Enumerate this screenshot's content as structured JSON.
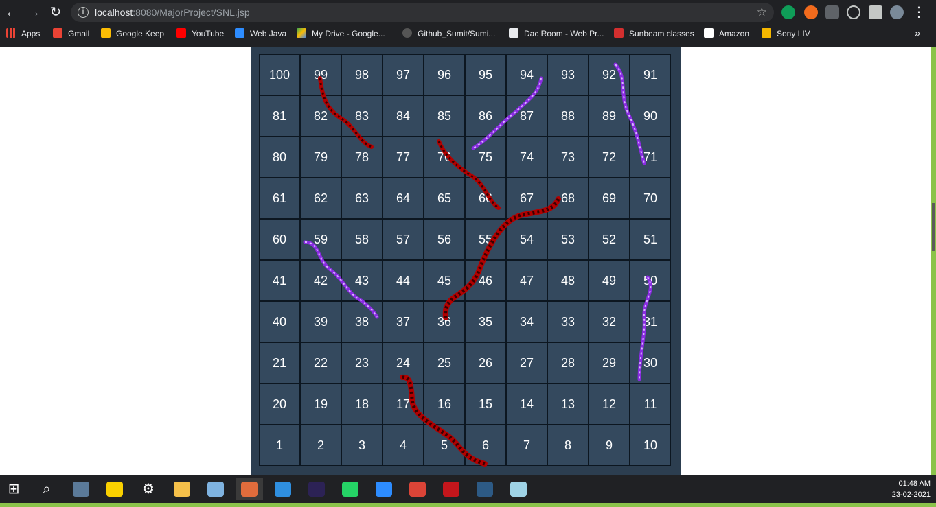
{
  "browser": {
    "url_host": "localhost",
    "url_path": ":8080/MajorProject/SNL.jsp",
    "back_icon": "←",
    "forward_icon": "→",
    "reload_icon": "↻",
    "star_icon": "☆",
    "menu_icon": "⋮",
    "bookmarks": [
      {
        "label": "Apps",
        "color": "#ea4335"
      },
      {
        "label": "Gmail",
        "color": "#ea4335"
      },
      {
        "label": "Google Keep",
        "color": "#fbbc04"
      },
      {
        "label": "YouTube",
        "color": "#ff0000"
      },
      {
        "label": "Web Java",
        "color": "#2d8cff"
      },
      {
        "label": "My Drive - Google...",
        "color": "#34a853"
      },
      {
        "label": "Github_Sumit/Sumi...",
        "color": "#555555"
      },
      {
        "label": "Dac Room - Web Pr...",
        "color": "#ffffff"
      },
      {
        "label": "Sunbeam classes",
        "color": "#d32f2f"
      },
      {
        "label": "Amazon",
        "color": "#ffffff"
      },
      {
        "label": "Sony LIV",
        "color": "#f5b700"
      }
    ],
    "more_bookmarks": "»"
  },
  "board": {
    "rows": [
      [
        "100",
        "99",
        "98",
        "97",
        "96",
        "95",
        "94",
        "93",
        "92",
        "91"
      ],
      [
        "81",
        "82",
        "83",
        "84",
        "85",
        "86",
        "87",
        "88",
        "89",
        "90"
      ],
      [
        "80",
        "79",
        "78",
        "77",
        "76",
        "75",
        "74",
        "73",
        "72",
        "71"
      ],
      [
        "61",
        "62",
        "63",
        "64",
        "65",
        "66",
        "67",
        "68",
        "69",
        "70"
      ],
      [
        "60",
        "59",
        "58",
        "57",
        "56",
        "55",
        "54",
        "53",
        "52",
        "51"
      ],
      [
        "41",
        "42",
        "43",
        "44",
        "45",
        "46",
        "47",
        "48",
        "49",
        "50"
      ],
      [
        "40",
        "39",
        "38",
        "37",
        "36",
        "35",
        "34",
        "33",
        "32",
        "31"
      ],
      [
        "21",
        "22",
        "23",
        "24",
        "25",
        "26",
        "27",
        "28",
        "29",
        "30"
      ],
      [
        "20",
        "19",
        "18",
        "17",
        "16",
        "15",
        "14",
        "13",
        "12",
        "11"
      ],
      [
        "1",
        "2",
        "3",
        "4",
        "5",
        "6",
        "7",
        "8",
        "9",
        "10"
      ]
    ],
    "red_snake_color": "#b30000",
    "purple_snake_color": "#8a2be2"
  },
  "taskbar": {
    "items": [
      {
        "name": "start-icon",
        "glyph": "⊞",
        "color": "#ffffff"
      },
      {
        "name": "search-icon",
        "glyph": "⌕",
        "color": "#ffffff"
      },
      {
        "name": "camera-app-icon",
        "glyph": "",
        "color": "#5b7a99"
      },
      {
        "name": "sticky-notes-icon",
        "glyph": "",
        "color": "#f9d000"
      },
      {
        "name": "settings-icon",
        "glyph": "⚙",
        "color": "#ffffff"
      },
      {
        "name": "file-explorer-icon",
        "glyph": "",
        "color": "#f5c04a"
      },
      {
        "name": "box-app-icon",
        "glyph": "",
        "color": "#7fb3e0"
      },
      {
        "name": "paint-app-icon",
        "glyph": "",
        "color": "#e06c3c"
      },
      {
        "name": "vscode-icon",
        "glyph": "",
        "color": "#2f8fe0"
      },
      {
        "name": "eclipse-icon",
        "glyph": "",
        "color": "#2c2255"
      },
      {
        "name": "whatsapp-icon",
        "glyph": "",
        "color": "#25d366"
      },
      {
        "name": "zoom-icon",
        "glyph": "",
        "color": "#2d8cff"
      },
      {
        "name": "chrome-icon",
        "glyph": "",
        "color": "#db4437"
      },
      {
        "name": "acrobat-icon",
        "glyph": "",
        "color": "#c4161c"
      },
      {
        "name": "mysql-workbench-icon",
        "glyph": "",
        "color": "#2d5a85"
      },
      {
        "name": "notes-app-icon",
        "glyph": "",
        "color": "#9fd3e6"
      }
    ],
    "time": "01:48 AM",
    "date": "23-02-2021"
  }
}
